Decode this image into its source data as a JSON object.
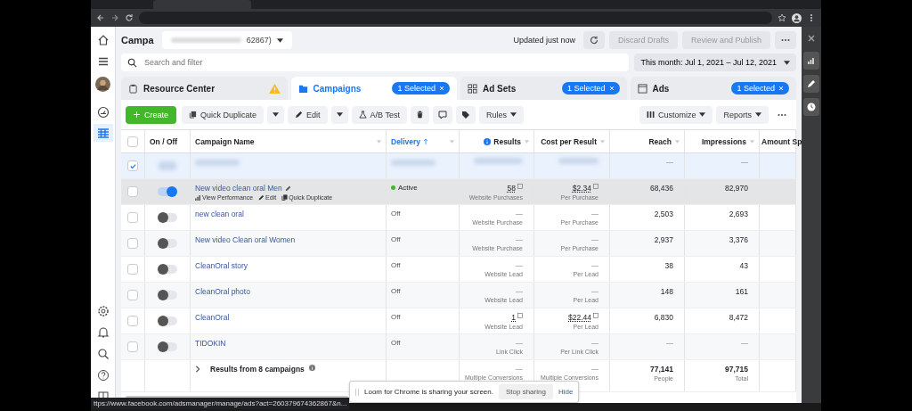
{
  "browser": {
    "status_url": "ttps://www.facebook.com/adsmanager/manage/ads?act=260379674362867&n..."
  },
  "header": {
    "title": "Campa",
    "account": "62867)",
    "updated": "Updated just now",
    "buttons": [
      {
        "label": "Discard Drafts",
        "disabled": true
      },
      {
        "label": "Review and Publish",
        "disabled": true
      }
    ]
  },
  "search": {
    "placeholder": "Search and filter"
  },
  "date_range": "This month: Jul 1, 2021 – Jul 12, 2021",
  "level_tabs": [
    {
      "label": "Resource Center",
      "kind": "resource",
      "selected": false,
      "warning": true
    },
    {
      "label": "Campaigns",
      "kind": "folder",
      "selected": true,
      "badge": "1 Selected"
    },
    {
      "label": "Ad Sets",
      "kind": "adsets",
      "selected": false,
      "badge": "1 Selected"
    },
    {
      "label": "Ads",
      "kind": "ads",
      "selected": false,
      "badge": "1 Selected"
    }
  ],
  "toolbar": {
    "create": "Create",
    "quick_duplicate": "Quick Duplicate",
    "edit": "Edit",
    "ab_test": "A/B Test",
    "rules": "Rules",
    "customize": "Customize",
    "reports": "Reports"
  },
  "select_all": {
    "checked": false
  },
  "columns": [
    {
      "label": "On / Off",
      "sorted": false,
      "info": false
    },
    {
      "label": "Campaign Name",
      "sorted": false,
      "info": false
    },
    {
      "label": "Delivery",
      "sorted": true,
      "info": false
    },
    {
      "label": "Results",
      "sorted": false,
      "info": true
    },
    {
      "label": "Cost per Result",
      "sorted": false,
      "info": false
    },
    {
      "label": "Reach",
      "sorted": false,
      "info": false
    },
    {
      "label": "Impressions",
      "sorted": false,
      "info": false
    },
    {
      "label": "Amount Sp",
      "sorted": false,
      "info": false
    }
  ],
  "rows": [
    {
      "kind": "blurred",
      "checked": true,
      "selected": true,
      "reach": "—",
      "impressions": "—"
    },
    {
      "kind": "campaign",
      "checked": false,
      "selected": false,
      "hovered": true,
      "on": true,
      "name": "New video clean oral Men",
      "actions": [
        "View Performance",
        "Edit",
        "Quick Duplicate"
      ],
      "delivery": "Active",
      "active": true,
      "results": "58",
      "results_label": "Website Purchases",
      "cost": "$2.34",
      "cost_label": "Per Purchase",
      "reach": "68,436",
      "impressions": "82,970"
    },
    {
      "kind": "campaign",
      "checked": false,
      "selected": false,
      "hovered": false,
      "on": false,
      "name": "new clean oral",
      "delivery": "Off",
      "active": false,
      "results": "—",
      "results_label": "Website Purchase",
      "cost": "—",
      "cost_label": "Per Purchase",
      "reach": "2,503",
      "impressions": "2,693"
    },
    {
      "kind": "campaign",
      "checked": false,
      "selected": false,
      "hovered": false,
      "on": false,
      "name": "New video Clean oral Women",
      "delivery": "Off",
      "active": false,
      "results": "—",
      "results_label": "Website Purchase",
      "cost": "—",
      "cost_label": "Per Purchase",
      "reach": "2,937",
      "impressions": "3,376"
    },
    {
      "kind": "campaign",
      "checked": false,
      "selected": false,
      "hovered": false,
      "on": false,
      "name": "CleanOral story",
      "delivery": "Off",
      "active": false,
      "results": "—",
      "results_label": "Website Lead",
      "cost": "—",
      "cost_label": "Per Lead",
      "reach": "38",
      "impressions": "43"
    },
    {
      "kind": "campaign",
      "checked": false,
      "selected": false,
      "hovered": false,
      "on": false,
      "name": "CleanOral photo",
      "delivery": "Off",
      "active": false,
      "results": "—",
      "results_label": "Website Lead",
      "cost": "—",
      "cost_label": "Per Lead",
      "reach": "148",
      "impressions": "161"
    },
    {
      "kind": "campaign",
      "checked": false,
      "selected": false,
      "hovered": false,
      "on": false,
      "name": "CleanOral",
      "delivery": "Off",
      "active": false,
      "results": "1",
      "results_label": "Website Lead",
      "cost": "$22.44",
      "cost_label": "Per Lead",
      "reach": "6,830",
      "impressions": "8,472"
    },
    {
      "kind": "campaign",
      "checked": false,
      "selected": false,
      "hovered": false,
      "on": false,
      "name": "TIDOKIN",
      "delivery": "Off",
      "active": false,
      "results": "—",
      "results_label": "Link Click",
      "cost": "—",
      "cost_label": "Per Link Click",
      "reach": "—",
      "impressions": "—"
    }
  ],
  "totals": {
    "label": "Results from 8 campaigns",
    "results": "—",
    "results_label": "Multiple Conversions",
    "cost": "—",
    "cost_label": "Multiple Conversions",
    "reach": "77,141",
    "reach_label": "People",
    "impressions": "97,715",
    "impressions_label": "Total"
  },
  "loom": {
    "message": "Loom for Chrome is sharing your screen.",
    "stop": "Stop sharing",
    "hide": "Hide"
  }
}
